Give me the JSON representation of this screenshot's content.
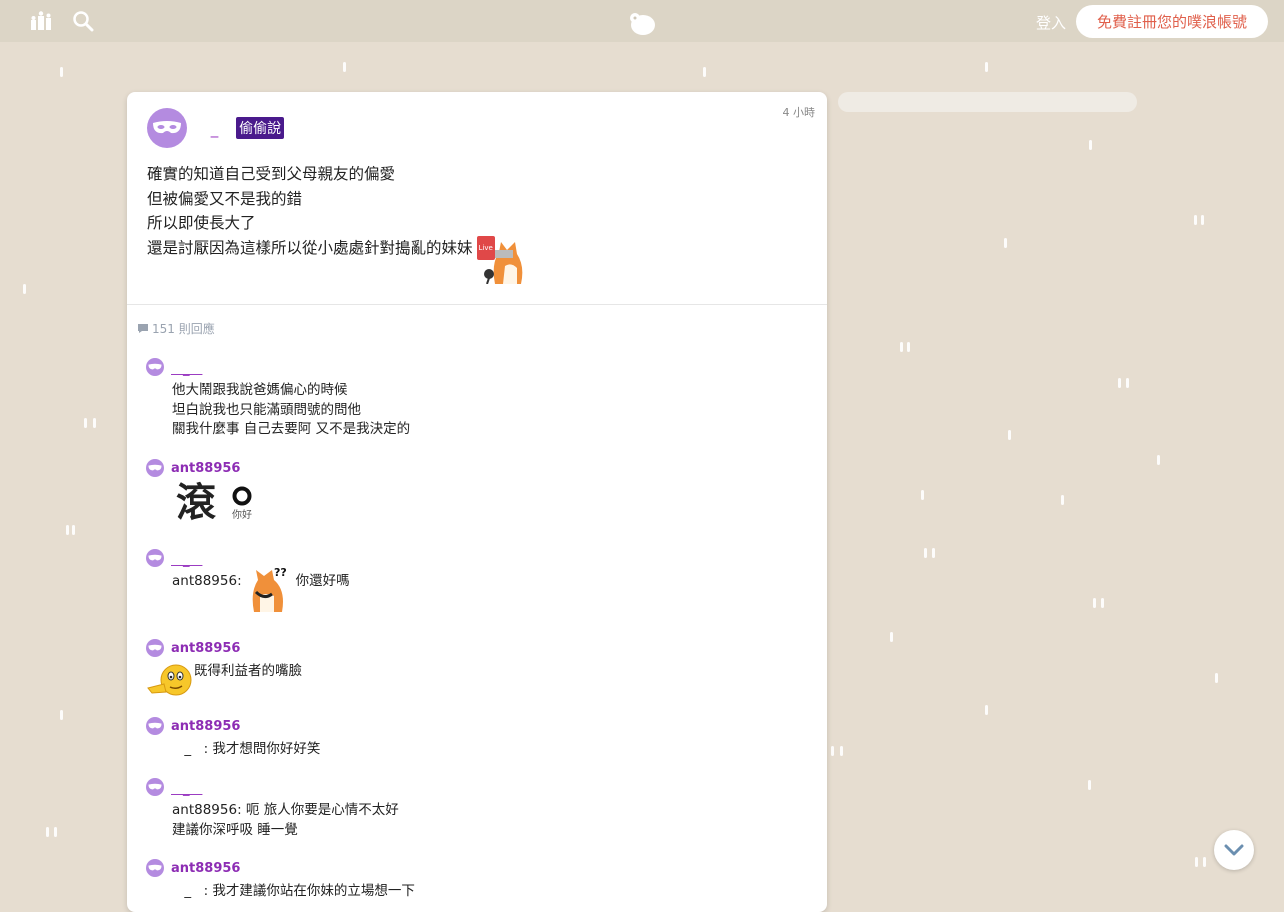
{
  "topbar": {
    "login_label": "登入",
    "signup_label": "免費註冊您的噗浪帳號",
    "icons": [
      "explore-icon",
      "search-icon",
      "plurk-logo-icon"
    ]
  },
  "post": {
    "author": "ﾠ_ﾠ",
    "anon_badge": "偷偷說",
    "time": "4 小時",
    "lines": [
      "確實的知道自己受到父母親友的偏愛",
      "但被偏愛又不是我的錯",
      "所以即使長大了",
      "還是討厭因為這樣所以從小處處針對搗亂的妹妹"
    ],
    "sticker_badge": "Live"
  },
  "responses": {
    "count_label": "151 則回應",
    "items": [
      {
        "name": "ﾠ_ﾠ",
        "anon": true,
        "lines": [
          "他大鬧跟我說爸媽偏心的時候",
          "坦白說我也只能滿頭問號的問他",
          "關我什麼事 自己去要阿 又不是我決定的"
        ]
      },
      {
        "name": "ant88956",
        "anon": false,
        "big": "滾",
        "small": "你好"
      },
      {
        "name": "ﾠ_ﾠ",
        "anon": true,
        "prefix": "ant88956:",
        "suffix": "你還好嗎"
      },
      {
        "name": "ant88956",
        "anon": false,
        "suffix": "既得利益者的嘴臉"
      },
      {
        "name": "ant88956",
        "anon": false,
        "lines": [
          "ﾠ_ﾠ: 我才想問你好好笑"
        ]
      },
      {
        "name": "ﾠ_ﾠ",
        "anon": true,
        "lines": [
          "ant88956: 呃 旅人你要是心情不太好",
          "建議你深呼吸 睡一覺"
        ]
      },
      {
        "name": "ant88956",
        "anon": false,
        "lines": [
          "ﾠ_ﾠ: 我才建議你站在你妹的立場想一下"
        ]
      }
    ]
  },
  "colors": {
    "background": "#e6ddd0",
    "topbar": "#dcd5c6",
    "signup_text": "#e0604c",
    "username": "#8d2db4",
    "anon_badge_bg": "#4a1a8c"
  }
}
